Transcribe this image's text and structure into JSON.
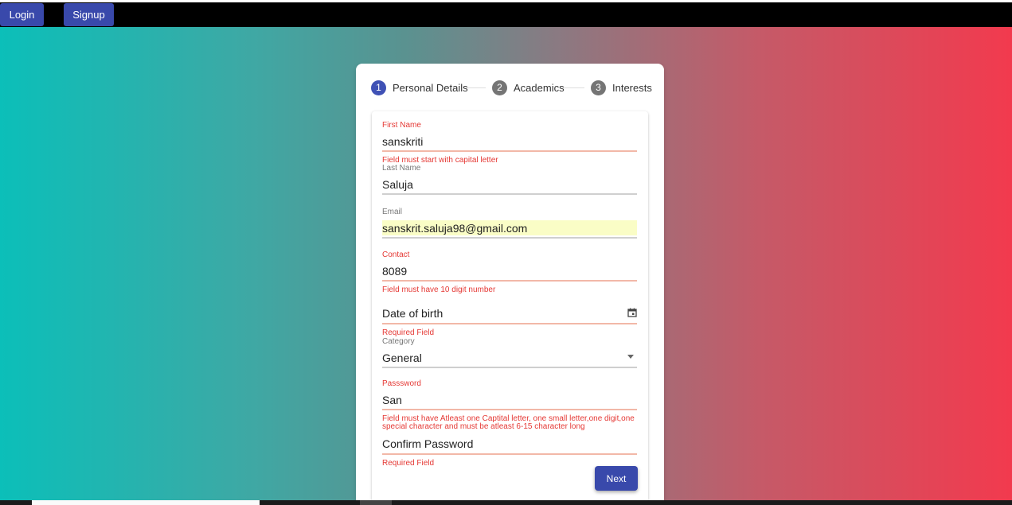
{
  "topbar": {
    "login_label": "Login",
    "signup_label": "Signup"
  },
  "stepper": {
    "steps": [
      {
        "number": "1",
        "label": "Personal Details",
        "active": true
      },
      {
        "number": "2",
        "label": "Academics",
        "active": false
      },
      {
        "number": "3",
        "label": "Interests",
        "active": false
      }
    ]
  },
  "form": {
    "first_name": {
      "label": "First Name",
      "value": "sanskriti",
      "error": "Field must start with capital letter"
    },
    "last_name": {
      "label": "Last Name",
      "value": "Saluja"
    },
    "email": {
      "label": "Email",
      "value": "sanskrit.saluja98@gmail.com"
    },
    "contact": {
      "label": "Contact",
      "value": "8089",
      "error": "Field must have 10 digit number"
    },
    "dob": {
      "placeholder": "Date of birth",
      "error": "Required Field",
      "icon": "calendar-icon"
    },
    "category": {
      "label": "Category",
      "value": "General",
      "icon": "dropdown-arrow-icon"
    },
    "password": {
      "label": "Passsword",
      "value": "San",
      "error": "Field must have Atleast one Captital letter, one small letter,one digit,one special character and must be atleast 6-15 character long"
    },
    "confirm_password": {
      "placeholder": "Confirm Password",
      "error": "Required Field"
    },
    "next_label": "Next"
  },
  "colors": {
    "primary": "#3949ab",
    "error": "#e53935",
    "gradient_left": "#0bbfb9",
    "gradient_right": "#f23a4e",
    "autofill_bg": "#fafdc6"
  }
}
